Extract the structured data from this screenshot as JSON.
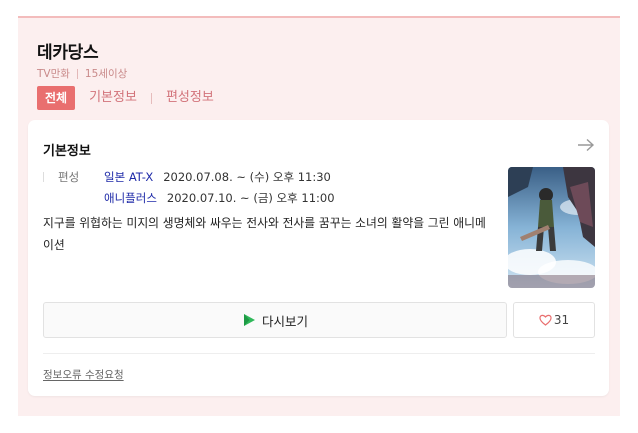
{
  "program": {
    "title": "데카당스",
    "type": "TV만화",
    "rating": "15세이상"
  },
  "tabs": {
    "all": "전체",
    "basic": "기본정보",
    "schedule": "편성정보"
  },
  "info": {
    "heading": "기본정보",
    "schedule_label": "편성",
    "schedule": [
      {
        "channel": "일본 AT-X",
        "time": "2020.07.08. ~ (수) 오후 11:30"
      },
      {
        "channel": "애니플러스",
        "time": "2020.07.10. ~ (금) 오후 11:00"
      }
    ],
    "description": "지구를 위협하는 미지의 생명체와 싸우는 전사와 전사를 꿈꾸는 소녀의 활약을 그린 애니메이션"
  },
  "actions": {
    "replay": "다시보기",
    "likes": "31"
  },
  "footer": {
    "report": "정보오류 수정요청"
  },
  "colors": {
    "accent": "#e96f6f",
    "panel_bg": "#fcefef",
    "channel": "#1e2aa8"
  },
  "icons": [
    "arrow-right-icon",
    "play-icon",
    "heart-icon"
  ]
}
